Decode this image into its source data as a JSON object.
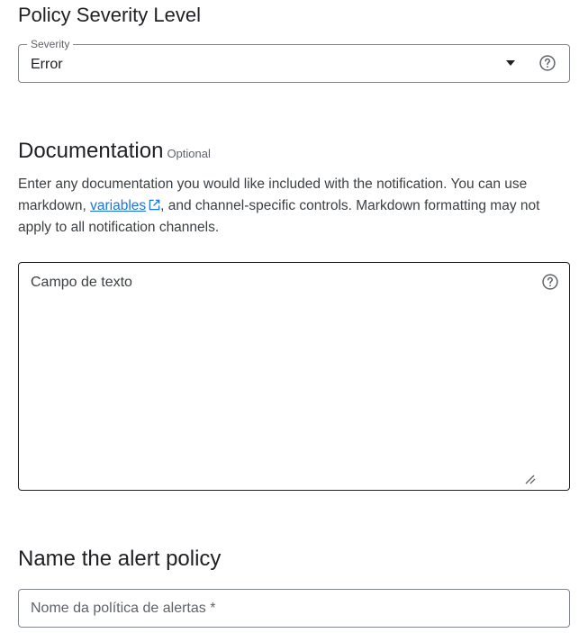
{
  "severity_section": {
    "title": "Policy Severity Level",
    "field_label": "Severity",
    "selected_value": "Error",
    "help_icon": "help-circle-icon",
    "dropdown_icon": "arrow-drop-down-icon"
  },
  "documentation_section": {
    "title": "Documentation",
    "optional_label": "Optional",
    "description_before_link": "Enter any documentation you would like included with the notification. You can use markdown, ",
    "link_text": "variables",
    "link_icon": "open-in-new-icon",
    "description_after_link": ", and channel-specific controls. Markdown formatting may not apply to all notification channels.",
    "textarea_value": "",
    "textarea_placeholder": "Campo de texto",
    "help_icon": "help-circle-icon"
  },
  "name_section": {
    "title": "Name the alert policy",
    "input_value": "",
    "input_placeholder": "Nome da política de alertas *"
  },
  "colors": {
    "text_primary": "#202124",
    "text_secondary": "#5f6368",
    "link": "#1a73e8",
    "outline": "#80868b"
  }
}
